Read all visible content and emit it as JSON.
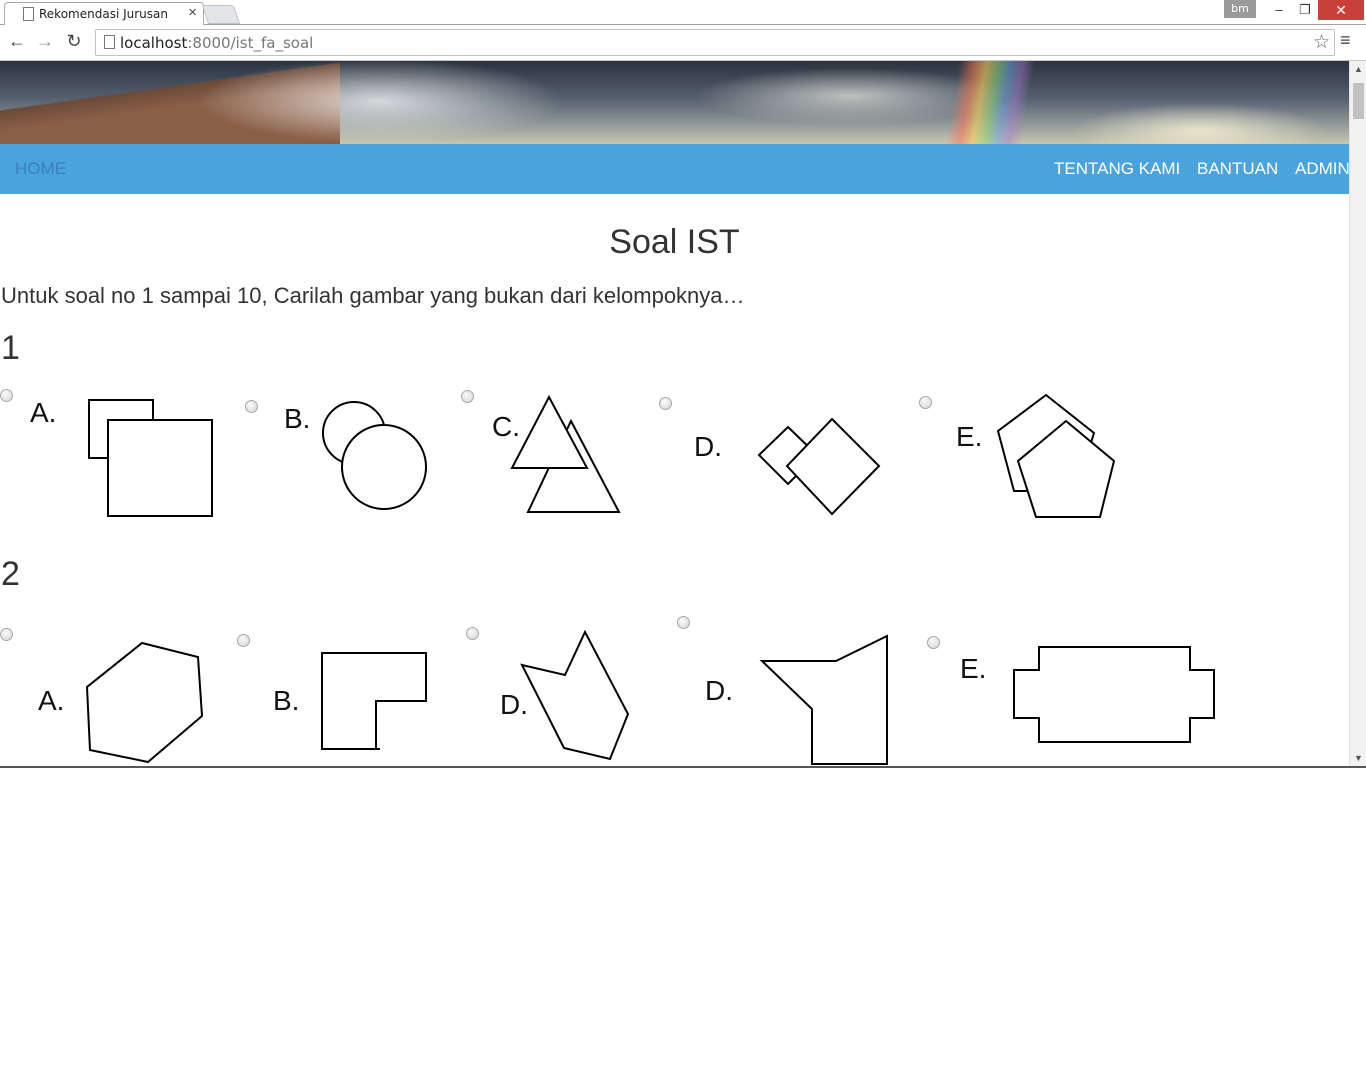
{
  "browser": {
    "tab_title": "Rekomendasi Jurusan",
    "url_host": "localhost",
    "url_rest": ":8000/ist_fa_soal",
    "user_badge": "bm"
  },
  "nav": {
    "home": "HOME",
    "about": "TENTANG KAMI",
    "help": "BANTUAN",
    "admin": "ADMIN"
  },
  "page": {
    "title": "Soal IST",
    "instruction": "Untuk soal no 1 sampai 10, Carilah gambar yang bukan dari kelompoknya…"
  },
  "questions": [
    {
      "number": "1",
      "options": [
        {
          "label": "A.",
          "figure": "two-overlapping-squares"
        },
        {
          "label": "B.",
          "figure": "two-overlapping-circles"
        },
        {
          "label": "C.",
          "figure": "two-overlapping-triangles"
        },
        {
          "label": "D.",
          "figure": "two-overlapping-diamonds"
        },
        {
          "label": "E.",
          "figure": "two-overlapping-pentagons"
        }
      ]
    },
    {
      "number": "2",
      "options": [
        {
          "label": "A.",
          "figure": "hexagon"
        },
        {
          "label": "B.",
          "figure": "l-shape"
        },
        {
          "label": "D.",
          "figure": "arrow-pentagon"
        },
        {
          "label": "D.",
          "figure": "funnel-shape"
        },
        {
          "label": "E.",
          "figure": "notched-rectangle"
        }
      ]
    }
  ]
}
